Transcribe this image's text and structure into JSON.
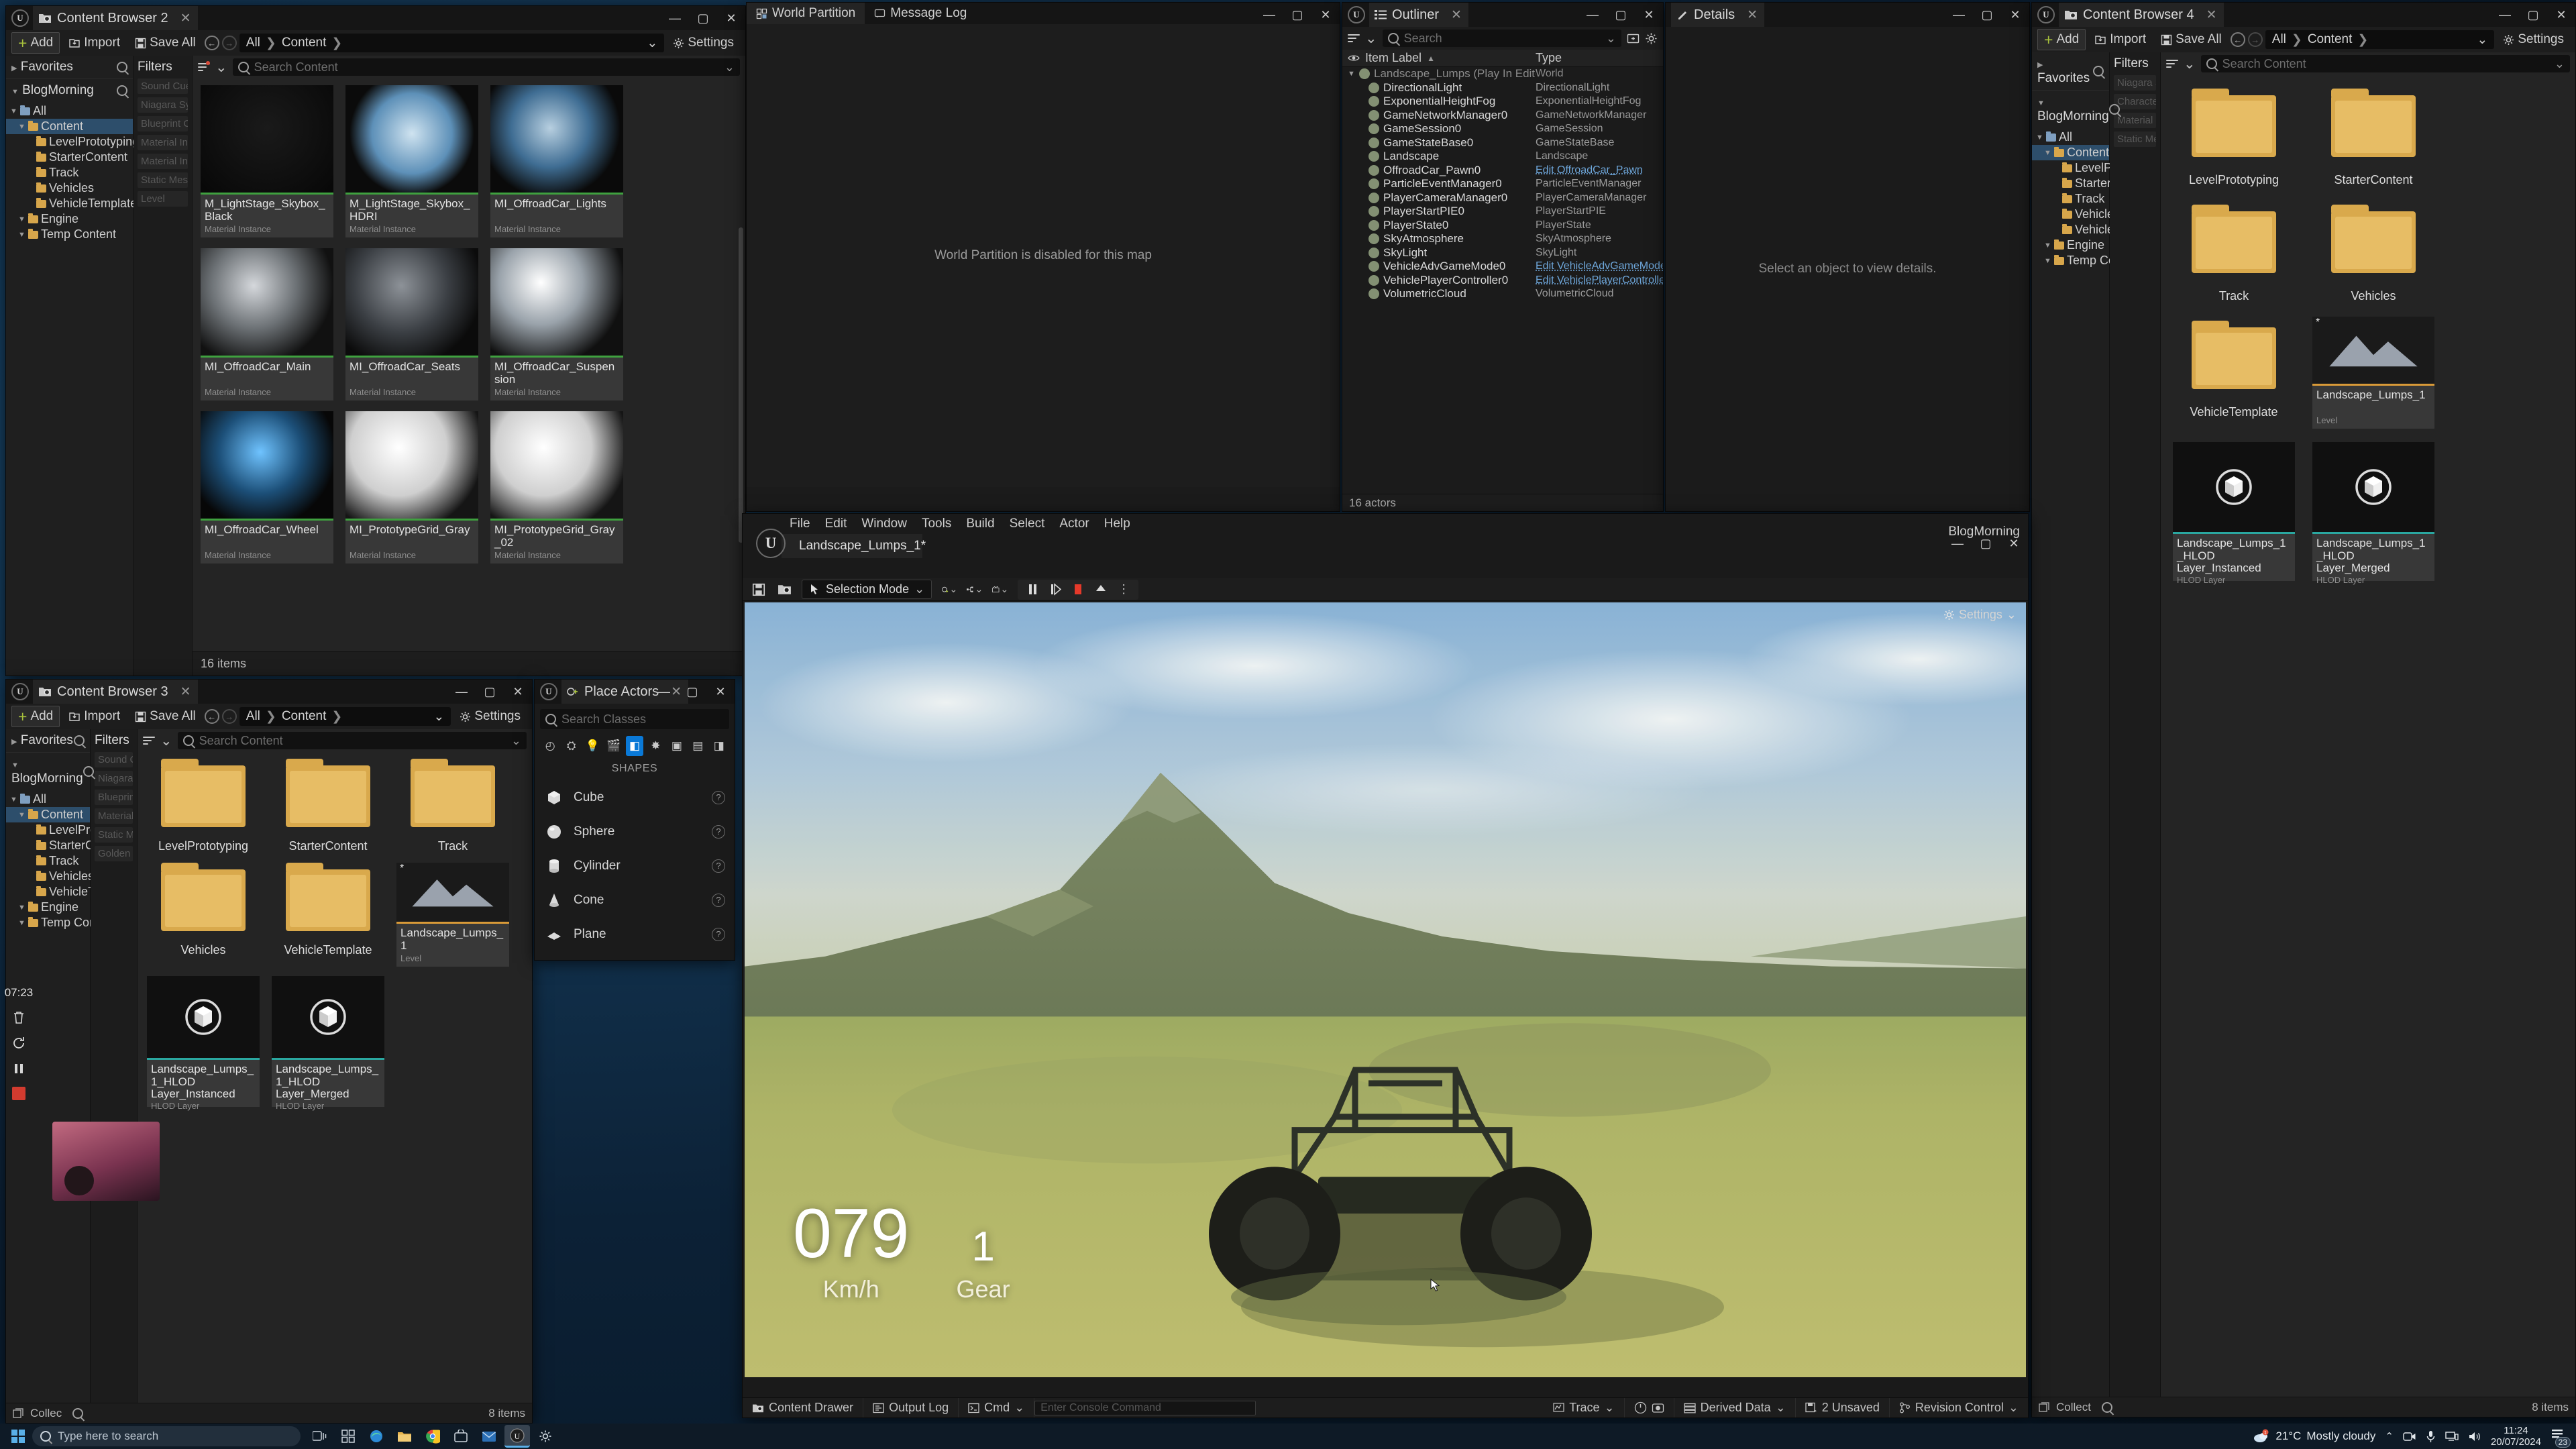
{
  "desktop": {
    "taskbar": {
      "start_icon": "windows-start-icon",
      "search_placeholder": "Type here to search",
      "pinned": [
        "task-view-icon",
        "widgets-icon",
        "edge-icon",
        "file-explorer-icon",
        "chrome-icon",
        "store-icon",
        "mail-icon",
        "unreal-editor-icon",
        "settings-icon"
      ],
      "weather_temp": "21°C",
      "weather_desc": "Mostly cloudy",
      "tray_icons": [
        "chevron-up-icon",
        "camera-icon",
        "microphone-icon",
        "network-icon",
        "volume-icon"
      ],
      "clock_time": "11:24",
      "clock_date": "20/07/2024",
      "notification_count": "23"
    }
  },
  "content_browser_2": {
    "title": "Content Browser 2",
    "toolbar": {
      "add": "Add",
      "import": "Import",
      "save_all": "Save All",
      "crumb_root": "All",
      "crumb_content": "Content",
      "settings": "Settings"
    },
    "sources": {
      "favorites": "Favorites",
      "project": "BlogMorning",
      "tree": [
        {
          "label": "All",
          "depth": 0,
          "selected": false
        },
        {
          "label": "Content",
          "depth": 1,
          "selected": true
        },
        {
          "label": "LevelPrototyping",
          "depth": 2,
          "selected": false
        },
        {
          "label": "StarterContent",
          "depth": 2,
          "selected": false
        },
        {
          "label": "Track",
          "depth": 2,
          "selected": false
        },
        {
          "label": "Vehicles",
          "depth": 2,
          "selected": false
        },
        {
          "label": "VehicleTemplate",
          "depth": 2,
          "selected": false
        },
        {
          "label": "Engine",
          "depth": 1,
          "selected": false
        },
        {
          "label": "Temp Content",
          "depth": 1,
          "selected": false
        }
      ]
    },
    "filters": {
      "label": "Filters",
      "items": [
        "Sound Cue",
        "Niagara System",
        "Blueprint Class",
        "Material Instance",
        "Material Instance",
        "Static Mesh",
        "Level"
      ]
    },
    "search_placeholder": "Search Content",
    "status": "16 items",
    "assets": [
      {
        "name": "M_LightStage_Skybox_Black",
        "type": "Material Instance",
        "thumb": "dark"
      },
      {
        "name": "M_LightStage_Skybox_HDRI",
        "type": "Material Instance",
        "thumb": "hdri"
      },
      {
        "name": "MI_OffroadCar_Lights",
        "type": "Material Instance",
        "thumb": "earth"
      },
      {
        "name": "MI_OffroadCar_Main",
        "type": "Material Instance",
        "thumb": "sphere-metal"
      },
      {
        "name": "MI_OffroadCar_Seats",
        "type": "Material Instance",
        "thumb": "sphere-dark"
      },
      {
        "name": "MI_OffroadCar_Suspension",
        "type": "Material Instance",
        "thumb": "sphere-chrome"
      },
      {
        "name": "MI_OffroadCar_Wheel",
        "type": "Material Instance",
        "thumb": "sphere-blue"
      },
      {
        "name": "MI_PrototypeGrid_Gray",
        "type": "Material Instance",
        "thumb": "sphere-white"
      },
      {
        "name": "MI_PrototypeGrid_Gray_02",
        "type": "Material Instance",
        "thumb": "sphere-white"
      }
    ]
  },
  "content_browser_3": {
    "title": "Content Browser 3",
    "toolbar": {
      "add": "Add",
      "import": "Import",
      "save_all": "Save All",
      "crumb_root": "All",
      "crumb_content": "Content",
      "settings": "Settings"
    },
    "sources": {
      "favorites": "Favorites",
      "project": "BlogMorning",
      "tree": [
        {
          "label": "All",
          "depth": 0,
          "selected": false
        },
        {
          "label": "Content",
          "depth": 1,
          "selected": true
        },
        {
          "label": "LevelProto",
          "depth": 2,
          "selected": false
        },
        {
          "label": "StarterCon",
          "depth": 2,
          "selected": false
        },
        {
          "label": "Track",
          "depth": 2,
          "selected": false
        },
        {
          "label": "Vehicles",
          "depth": 2,
          "selected": false
        },
        {
          "label": "VehicleTem",
          "depth": 2,
          "selected": false
        },
        {
          "label": "Engine",
          "depth": 1,
          "selected": false
        },
        {
          "label": "Temp Content",
          "depth": 1,
          "selected": false
        }
      ]
    },
    "filters": {
      "label": "Filters",
      "items": [
        "Sound Cue",
        "Niagara Sys",
        "Blueprint Cl",
        "Material Ins",
        "Static Mesh",
        "Golden"
      ]
    },
    "search_placeholder": "Search Content",
    "status": "8 items",
    "collections": "Collec",
    "folders": [
      {
        "name": "LevelPrototyping"
      },
      {
        "name": "StarterContent"
      },
      {
        "name": "Track"
      },
      {
        "name": "Vehicles"
      },
      {
        "name": "VehicleTemplate"
      }
    ],
    "level_tile": {
      "name": "Landscape_Lumps_1",
      "type": "Level",
      "dirty": "*"
    },
    "hlod_tiles": [
      {
        "name": "Landscape_Lumps_1_HLOD\nLayer_Instanced",
        "type": "HLOD Layer"
      },
      {
        "name": "Landscape_Lumps_1_HLOD\nLayer_Merged",
        "type": "HLOD Layer"
      }
    ]
  },
  "content_browser_4": {
    "title": "Content Browser 4",
    "toolbar": {
      "add": "Add",
      "import": "Import",
      "save_all": "Save All",
      "crumb_root": "All",
      "crumb_content": "Content",
      "settings": "Settings"
    },
    "sources": {
      "favorites": "Favorites",
      "project": "BlogMorning",
      "tree": [
        {
          "label": "All",
          "depth": 0,
          "selected": false
        },
        {
          "label": "Content",
          "depth": 1,
          "selected": true
        },
        {
          "label": "LevelProtot",
          "depth": 2,
          "selected": false
        },
        {
          "label": "StarterCont",
          "depth": 2,
          "selected": false
        },
        {
          "label": "Track",
          "depth": 2,
          "selected": false
        },
        {
          "label": "Vehicles",
          "depth": 2,
          "selected": false
        },
        {
          "label": "VehicleTem",
          "depth": 2,
          "selected": false
        },
        {
          "label": "Engine",
          "depth": 1,
          "selected": false
        },
        {
          "label": "Temp Content",
          "depth": 1,
          "selected": false
        }
      ]
    },
    "filters": {
      "label": "Filters",
      "items": [
        "Niagara Sys",
        "Character Cl",
        "Material Ins",
        "Static Mesh"
      ]
    },
    "search_placeholder": "Search Content",
    "status": "8 items",
    "collections": "Collect",
    "folders": [
      {
        "name": "LevelPrototyping"
      },
      {
        "name": "StarterContent"
      },
      {
        "name": "Track"
      },
      {
        "name": "Vehicles"
      },
      {
        "name": "VehicleTemplate"
      }
    ],
    "level_tile": {
      "name": "Landscape_Lumps_1",
      "type": "Level",
      "dirty": "*"
    },
    "hlod_tiles": [
      {
        "name": "Landscape_Lumps_1_HLOD\nLayer_Instanced",
        "type": "HLOD Layer"
      },
      {
        "name": "Landscape_Lumps_1_HLOD\nLayer_Merged",
        "type": "HLOD Layer"
      }
    ]
  },
  "world_partition": {
    "tabs": [
      {
        "label": "World Partition",
        "active": true,
        "icon": "world-partition-icon"
      },
      {
        "label": "Message Log",
        "active": false,
        "icon": "message-log-icon"
      }
    ],
    "message": "World Partition is disabled for this map"
  },
  "outliner": {
    "title": "Outliner",
    "search_placeholder": "Search",
    "columns": {
      "item_label": "Item Label",
      "type": "Type"
    },
    "sort_indicator": "▲",
    "rows": [
      {
        "label": "Landscape_Lumps (Play In Editor)",
        "type": "World",
        "depth": 0,
        "icon": "landscape-icon",
        "link": false,
        "expanded": true
      },
      {
        "label": "DirectionalLight",
        "type": "DirectionalLight",
        "depth": 1,
        "icon": "directional-light-icon",
        "link": false
      },
      {
        "label": "ExponentialHeightFog",
        "type": "ExponentialHeightFog",
        "depth": 1,
        "icon": "fog-icon",
        "link": false
      },
      {
        "label": "GameNetworkManager0",
        "type": "GameNetworkManager",
        "depth": 1,
        "icon": "actor-icon",
        "link": false
      },
      {
        "label": "GameSession0",
        "type": "GameSession",
        "depth": 1,
        "icon": "actor-icon",
        "link": false
      },
      {
        "label": "GameStateBase0",
        "type": "GameStateBase",
        "depth": 1,
        "icon": "gamestate-icon",
        "link": false
      },
      {
        "label": "Landscape",
        "type": "Landscape",
        "depth": 1,
        "icon": "landscape-icon",
        "link": false
      },
      {
        "label": "OffroadCar_Pawn0",
        "type": "Edit OffroadCar_Pawn",
        "depth": 1,
        "icon": "pawn-icon",
        "link": true
      },
      {
        "label": "ParticleEventManager0",
        "type": "ParticleEventManager",
        "depth": 1,
        "icon": "actor-icon",
        "link": false
      },
      {
        "label": "PlayerCameraManager0",
        "type": "PlayerCameraManager",
        "depth": 1,
        "icon": "actor-icon",
        "link": false
      },
      {
        "label": "PlayerStartPIE0",
        "type": "PlayerStartPIE",
        "depth": 1,
        "icon": "playerstart-icon",
        "link": false
      },
      {
        "label": "PlayerState0",
        "type": "PlayerState",
        "depth": 1,
        "icon": "actor-icon",
        "link": false
      },
      {
        "label": "SkyAtmosphere",
        "type": "SkyAtmosphere",
        "depth": 1,
        "icon": "sky-icon",
        "link": false
      },
      {
        "label": "SkyLight",
        "type": "SkyLight",
        "depth": 1,
        "icon": "skylight-icon",
        "link": false
      },
      {
        "label": "VehicleAdvGameMode0",
        "type": "Edit VehicleAdvGameMode",
        "depth": 1,
        "icon": "gamemode-icon",
        "link": true
      },
      {
        "label": "VehiclePlayerController0",
        "type": "Edit VehiclePlayerController",
        "depth": 1,
        "icon": "controller-icon",
        "link": true
      },
      {
        "label": "VolumetricCloud",
        "type": "VolumetricCloud",
        "depth": 1,
        "icon": "cloud-icon",
        "link": false
      }
    ],
    "status": "16 actors"
  },
  "details": {
    "title": "Details",
    "empty_message": "Select an object to view details."
  },
  "editor": {
    "window_user": "BlogMorning",
    "menus": [
      "File",
      "Edit",
      "Window",
      "Tools",
      "Build",
      "Select",
      "Actor",
      "Help"
    ],
    "level_tab": "Landscape_Lumps_1",
    "level_tab_dirty": "*",
    "toolbar": {
      "save_icon": "save-icon",
      "browse_icon": "browse-icon",
      "mode": "Selection Mode",
      "add_icon": "add-actor-icon",
      "blueprint_icon": "blueprints-icon",
      "cinematics_icon": "cinematics-icon",
      "pause_icon": "pause-icon",
      "step_icon": "frame-step-icon",
      "stop_icon": "stop-icon",
      "eject_icon": "eject-icon",
      "more_icon": "more-options-icon",
      "settings": "Settings"
    },
    "hud": {
      "speed": "079",
      "speed_unit": "Km/h",
      "gear": "1",
      "gear_label": "Gear"
    },
    "status_left": [
      {
        "label": "Content Drawer",
        "icon": "content-drawer-icon"
      },
      {
        "label": "Output Log",
        "icon": "output-log-icon"
      },
      {
        "label": "Cmd",
        "icon": "cmd-icon"
      }
    ],
    "console_placeholder": "Enter Console Command",
    "status_right": [
      {
        "label": "Trace",
        "icon": "trace-icon"
      },
      {
        "label": "Derived Data",
        "icon": "derived-data-icon"
      },
      {
        "label": "2 Unsaved",
        "icon": "unsaved-icon"
      },
      {
        "label": "Revision Control",
        "icon": "revision-control-icon"
      }
    ]
  },
  "place_actors": {
    "title": "Place Actors",
    "search_placeholder": "Search Classes",
    "category_icons": [
      "recent-icon",
      "basic-icon",
      "lights-icon",
      "cinematic-icon",
      "shapes-icon",
      "visual-effects-icon",
      "volumes-icon",
      "all-classes-icon",
      "geometry-icon"
    ],
    "section": "SHAPES",
    "items": [
      {
        "label": "Cube",
        "icon": "cube-icon"
      },
      {
        "label": "Sphere",
        "icon": "sphere-icon"
      },
      {
        "label": "Cylinder",
        "icon": "cylinder-icon"
      },
      {
        "label": "Cone",
        "icon": "cone-icon"
      },
      {
        "label": "Plane",
        "icon": "plane-icon"
      }
    ]
  },
  "recorder_dock": {
    "timer": "07:23",
    "buttons": [
      "delete-icon",
      "restart-icon",
      "pause-icon",
      "stop-record-icon"
    ]
  }
}
